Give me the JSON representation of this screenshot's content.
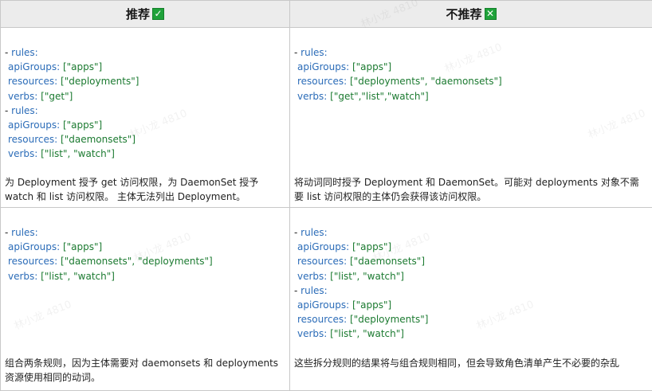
{
  "header": {
    "recommended": "推荐",
    "not_recommended": "不推荐",
    "check_glyph": "✓",
    "cross_glyph": "✕",
    "mark_color": "#1fa23a"
  },
  "rows": [
    {
      "left": {
        "rules": [
          {
            "apiGroups": "[\"apps\"]",
            "resources": "[\"deployments\"]",
            "verbs": "[\"get\"]"
          },
          {
            "apiGroups": "[\"apps\"]",
            "resources": "[\"daemonsets\"]",
            "verbs": "[\"list\", \"watch\"]"
          }
        ],
        "description": "为 Deployment 授予 get 访问权限，为 DaemonSet 授予 watch 和 list 访问权限。 主体无法列出 Deployment。"
      },
      "right": {
        "rules": [
          {
            "apiGroups": "[\"apps\"]",
            "resources": "[\"deployments\", \"daemonsets\"]",
            "verbs": "[\"get\",\"list\",\"watch\"]"
          }
        ],
        "description": "将动词同时授予 Deployment 和 DaemonSet。可能对 deployments 对象不需要 list 访问权限的主体仍会获得该访问权限。"
      }
    },
    {
      "left": {
        "rules": [
          {
            "apiGroups": "[\"apps\"]",
            "resources": "[\"daemonsets\", \"deployments\"]",
            "verbs": "[\"list\", \"watch\"]"
          }
        ],
        "description": "组合两条规则，因为主体需要对 daemonsets 和 deployments 资源使用相同的动词。"
      },
      "right": {
        "rules": [
          {
            "apiGroups": "[\"apps\"]",
            "resources": "[\"daemonsets\"]",
            "verbs": "[\"list\", \"watch\"]"
          },
          {
            "apiGroups": "[\"apps\"]",
            "resources": "[\"deployments\"]",
            "verbs": "[\"list\", \"watch\"]"
          }
        ],
        "description": "这些拆分规则的结果将与组合规则相同，但会导致角色清单产生不必要的杂乱"
      }
    }
  ],
  "syntax": {
    "dash": "- ",
    "rules_key": "rules:",
    "apiGroups_key": "apiGroups: ",
    "resources_key": "resources: ",
    "verbs_key": "verbs: "
  },
  "watermark": "林小龙 4810"
}
